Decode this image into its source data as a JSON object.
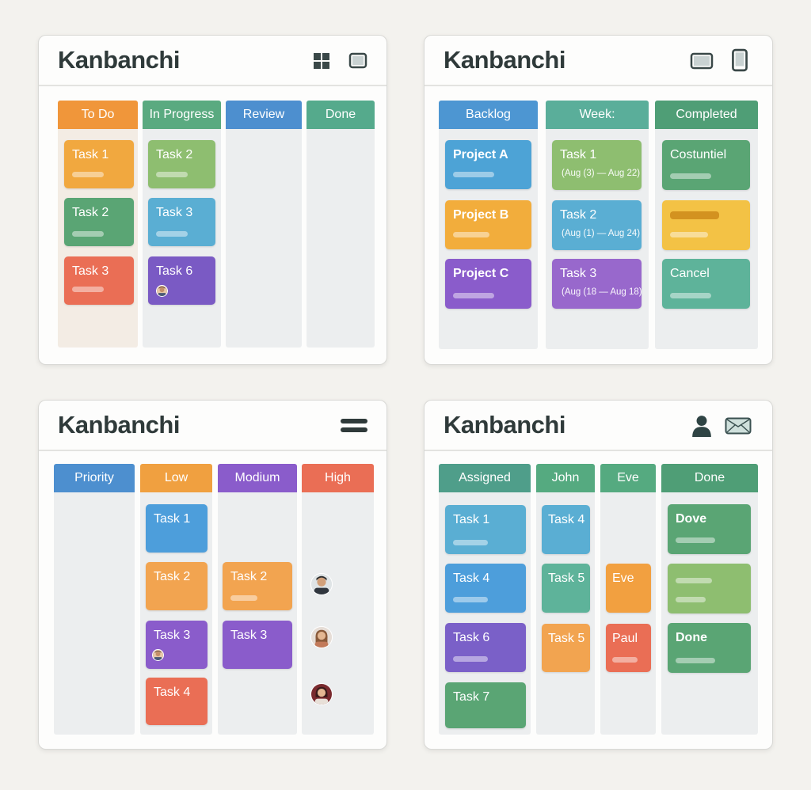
{
  "colors": {
    "orange": "#f0963a",
    "green": "#5aaa80",
    "blue": "#4d8fcf",
    "teal": "#55aa8c",
    "red": "#ea6e55",
    "purple": "#8058c2",
    "yellow": "#f3b848",
    "lightblue": "#5aaed3",
    "lightgreen": "#8ebe70"
  },
  "board1": {
    "title": "Kanbanchi",
    "icons": [
      "grid-icon",
      "window-icon"
    ],
    "columns": [
      "To Do",
      "In Progress",
      "Review",
      "Done"
    ],
    "cards": {
      "todo": [
        "Task 1",
        "Task 2",
        "Task 3"
      ],
      "progress": [
        "Task 2",
        "Task 3",
        "Task 6"
      ]
    }
  },
  "board2": {
    "title": "Kanbanchi",
    "icons": [
      "tablet-landscape-icon",
      "tablet-portrait-icon"
    ],
    "columns": [
      "Backlog",
      "Week:",
      "Completed"
    ],
    "backlog": [
      "Project A",
      "Project B",
      "Project C"
    ],
    "week": [
      {
        "label": "Task 1",
        "dates": "(Aug (3) — Aug 22)"
      },
      {
        "label": "Task 2",
        "dates": "(Aug (1) — Aug 24)"
      },
      {
        "label": "Task 3",
        "dates": "(Aug (18 — Aug 18)"
      }
    ],
    "completed": [
      "Costuntiel",
      "",
      "Cancel"
    ]
  },
  "board3": {
    "title": "Kanbanchi",
    "icons": [
      "menu-icon"
    ],
    "columns": [
      "Priority",
      "Low",
      "Modium",
      "High"
    ],
    "low": [
      "Task 1",
      "Task 2",
      "Task 3",
      "Task 4"
    ],
    "medium": [
      "Task 2",
      "Task 3"
    ]
  },
  "board4": {
    "title": "Kanbanchi",
    "icons": [
      "user-icon",
      "mail-icon"
    ],
    "columns": [
      "Assigned",
      "John",
      "Eve",
      "Done"
    ],
    "assigned": [
      "Task 1",
      "Task 4",
      "Task 6",
      "Task 7"
    ],
    "john": [
      "Task 4",
      "Task 5",
      "Task 5"
    ],
    "eve": [
      "Eve",
      "Paul"
    ],
    "done": [
      "Dove",
      "",
      "Done"
    ]
  }
}
